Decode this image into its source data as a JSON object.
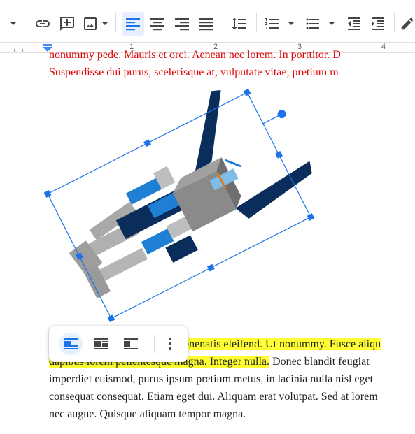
{
  "toolbar": {
    "items": [
      "more-dropdown",
      "insert-link",
      "insert-comment",
      "insert-image",
      "align-left",
      "align-center",
      "align-right",
      "align-justify",
      "line-spacing",
      "numbered-list",
      "bulleted-list",
      "decrease-indent",
      "increase-indent",
      "edit"
    ],
    "accent": "#1a73e8",
    "icon_color": "#444746"
  },
  "ruler": {
    "numbers": [
      "1",
      "2",
      "3",
      "4"
    ]
  },
  "doc": {
    "top_line1": "nonummy pede. Mauris et orci. Aenean nec lorem. In porttitor. D",
    "top_line2": "Suspendisse dui purus, scelerisque at, vulputate vitae, pretium m",
    "body_line1_hl": "venenatis eleifend. Ut nonummy. Fusce aliqu",
    "body_line2_hl": "dapibus lorem pellentesque magna. Integer nulla.",
    "body_line2_rest": " Donec blandit feugiat",
    "body_line3": "imperdiet euismod, purus ipsum pretium metus, in lacinia nulla nisl eget",
    "body_line4": "consequat consequat. Etiam eget dui. Aliquam erat volutpat. Sed at lorem",
    "body_line5": "nec augue. Quisque aliquam tempor magna.",
    "text_red": "#e00000",
    "highlight": "#ffff33"
  },
  "image": {
    "subject": "robot-astronaut-illustration",
    "rotation_deg": -27,
    "selection_color": "#1a73e8"
  },
  "image_toolbar": {
    "options": [
      "in-line",
      "wrap-text",
      "break-text",
      "more-options"
    ],
    "selected": "in-line"
  }
}
